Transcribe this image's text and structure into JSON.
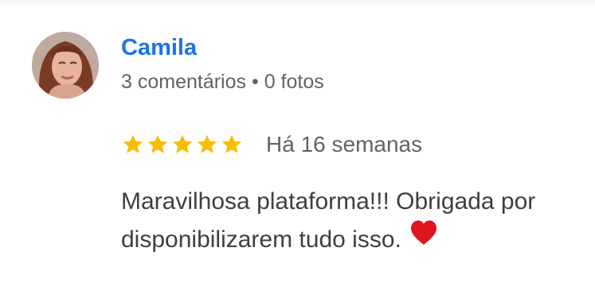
{
  "review": {
    "author_name": "Camila",
    "comment_count": "3 comentários",
    "separator": "•",
    "photo_count": "0 fotos",
    "rating": 5,
    "rating_max": 5,
    "time_ago": "Há 16 semanas",
    "text_line_1": "Maravilhosa plataforma!!! Obrigada por",
    "text_line_2": "disponibilizarem tudo isso.",
    "emoji": "heart-icon"
  },
  "colors": {
    "author_name": "#1a73e8",
    "secondary_text": "#5f6368",
    "body_text": "#3c4043",
    "star": "#fbbc04",
    "heart": "#e1141d"
  }
}
